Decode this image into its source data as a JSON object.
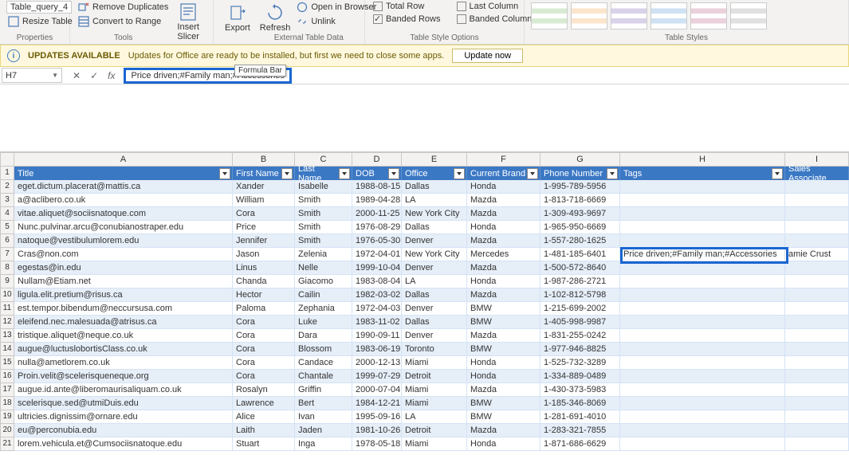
{
  "ribbon": {
    "tablename_label": "Table_query_4",
    "resize_table": "Resize Table",
    "properties_group": "Properties",
    "remove_duplicates": "Remove Duplicates",
    "convert_to_range": "Convert to Range",
    "tools_group": "Tools",
    "insert_slicer": "Insert Slicer",
    "export": "Export",
    "refresh": "Refresh",
    "open_in_browser": "Open in Browser",
    "unlink": "Unlink",
    "external_group": "External Table Data",
    "total_row": "Total Row",
    "banded_rows": "Banded Rows",
    "last_column": "Last Column",
    "banded_columns": "Banded Columns",
    "styleopts_group": "Table Style Options",
    "styles_group": "Table Styles"
  },
  "update_bar": {
    "title": "UPDATES AVAILABLE",
    "msg": "Updates for Office are ready to be installed, but first we need to close some apps.",
    "btn": "Update now"
  },
  "formula_bar": {
    "namebox": "H7",
    "formula": "Price driven;#Family man;#Accessories",
    "tooltip": "Formula Bar"
  },
  "columns": [
    "A",
    "B",
    "C",
    "D",
    "E",
    "F",
    "G",
    "H",
    "I"
  ],
  "headers": {
    "A": "Title",
    "B": "First Name",
    "C": "Last Name",
    "D": "DOB",
    "E": "Office",
    "F": "Current Brand",
    "G": "Phone Number",
    "H": "Tags",
    "I": "Sales Associate"
  },
  "rows": [
    {
      "n": 2,
      "A": "eget.dictum.placerat@mattis.ca",
      "B": "Xander",
      "C": "Isabelle",
      "D": "1988-08-15",
      "E": "Dallas",
      "F": "Honda",
      "G": "1-995-789-5956",
      "H": "",
      "I": ""
    },
    {
      "n": 3,
      "A": "a@aclibero.co.uk",
      "B": "William",
      "C": "Smith",
      "D": "1989-04-28",
      "E": "LA",
      "F": "Mazda",
      "G": "1-813-718-6669",
      "H": "",
      "I": ""
    },
    {
      "n": 4,
      "A": "vitae.aliquet@sociisnatoque.com",
      "B": "Cora",
      "C": "Smith",
      "D": "2000-11-25",
      "E": "New York City",
      "F": "Mazda",
      "G": "1-309-493-9697",
      "H": "",
      "I": ""
    },
    {
      "n": 5,
      "A": "Nunc.pulvinar.arcu@conubianostraper.edu",
      "B": "Price",
      "C": "Smith",
      "D": "1976-08-29",
      "E": "Dallas",
      "F": "Honda",
      "G": "1-965-950-6669",
      "H": "",
      "I": ""
    },
    {
      "n": 6,
      "A": "natoque@vestibulumlorem.edu",
      "B": "Jennifer",
      "C": "Smith",
      "D": "1976-05-30",
      "E": "Denver",
      "F": "Mazda",
      "G": "1-557-280-1625",
      "H": "",
      "I": ""
    },
    {
      "n": 7,
      "A": "Cras@non.com",
      "B": "Jason",
      "C": "Zelenia",
      "D": "1972-04-01",
      "E": "New York City",
      "F": "Mercedes",
      "G": "1-481-185-6401",
      "H": "Price driven;#Family man;#Accessories",
      "I": "amie Crust"
    },
    {
      "n": 8,
      "A": "egestas@in.edu",
      "B": "Linus",
      "C": "Nelle",
      "D": "1999-10-04",
      "E": "Denver",
      "F": "Mazda",
      "G": "1-500-572-8640",
      "H": "",
      "I": ""
    },
    {
      "n": 9,
      "A": "Nullam@Etiam.net",
      "B": "Chanda",
      "C": "Giacomo",
      "D": "1983-08-04",
      "E": "LA",
      "F": "Honda",
      "G": "1-987-286-2721",
      "H": "",
      "I": ""
    },
    {
      "n": 10,
      "A": "ligula.elit.pretium@risus.ca",
      "B": "Hector",
      "C": "Cailin",
      "D": "1982-03-02",
      "E": "Dallas",
      "F": "Mazda",
      "G": "1-102-812-5798",
      "H": "",
      "I": ""
    },
    {
      "n": 11,
      "A": "est.tempor.bibendum@neccursusa.com",
      "B": "Paloma",
      "C": "Zephania",
      "D": "1972-04-03",
      "E": "Denver",
      "F": "BMW",
      "G": "1-215-699-2002",
      "H": "",
      "I": ""
    },
    {
      "n": 12,
      "A": "eleifend.nec.malesuada@atrisus.ca",
      "B": "Cora",
      "C": "Luke",
      "D": "1983-11-02",
      "E": "Dallas",
      "F": "BMW",
      "G": "1-405-998-9987",
      "H": "",
      "I": ""
    },
    {
      "n": 13,
      "A": "tristique.aliquet@neque.co.uk",
      "B": "Cora",
      "C": "Dara",
      "D": "1990-09-11",
      "E": "Denver",
      "F": "Mazda",
      "G": "1-831-255-0242",
      "H": "",
      "I": ""
    },
    {
      "n": 14,
      "A": "augue@luctuslobortisClass.co.uk",
      "B": "Cora",
      "C": "Blossom",
      "D": "1983-06-19",
      "E": "Toronto",
      "F": "BMW",
      "G": "1-977-946-8825",
      "H": "",
      "I": ""
    },
    {
      "n": 15,
      "A": "nulla@ametlorem.co.uk",
      "B": "Cora",
      "C": "Candace",
      "D": "2000-12-13",
      "E": "Miami",
      "F": "Honda",
      "G": "1-525-732-3289",
      "H": "",
      "I": ""
    },
    {
      "n": 16,
      "A": "Proin.velit@scelerisqueneque.org",
      "B": "Cora",
      "C": "Chantale",
      "D": "1999-07-29",
      "E": "Detroit",
      "F": "Honda",
      "G": "1-334-889-0489",
      "H": "",
      "I": ""
    },
    {
      "n": 17,
      "A": "augue.id.ante@liberomaurisaliquam.co.uk",
      "B": "Rosalyn",
      "C": "Griffin",
      "D": "2000-07-04",
      "E": "Miami",
      "F": "Mazda",
      "G": "1-430-373-5983",
      "H": "",
      "I": ""
    },
    {
      "n": 18,
      "A": "scelerisque.sed@utmiDuis.edu",
      "B": "Lawrence",
      "C": "Bert",
      "D": "1984-12-21",
      "E": "Miami",
      "F": "BMW",
      "G": "1-185-346-8069",
      "H": "",
      "I": ""
    },
    {
      "n": 19,
      "A": "ultricies.dignissim@ornare.edu",
      "B": "Alice",
      "C": "Ivan",
      "D": "1995-09-16",
      "E": "LA",
      "F": "BMW",
      "G": "1-281-691-4010",
      "H": "",
      "I": ""
    },
    {
      "n": 20,
      "A": "eu@perconubia.edu",
      "B": "Laith",
      "C": "Jaden",
      "D": "1981-10-26",
      "E": "Detroit",
      "F": "Mazda",
      "G": "1-283-321-7855",
      "H": "",
      "I": ""
    },
    {
      "n": 21,
      "A": "lorem.vehicula.et@Cumsociisnatoque.edu",
      "B": "Stuart",
      "C": "Inga",
      "D": "1978-05-18",
      "E": "Miami",
      "F": "Honda",
      "G": "1-871-686-6629",
      "H": "",
      "I": ""
    }
  ]
}
